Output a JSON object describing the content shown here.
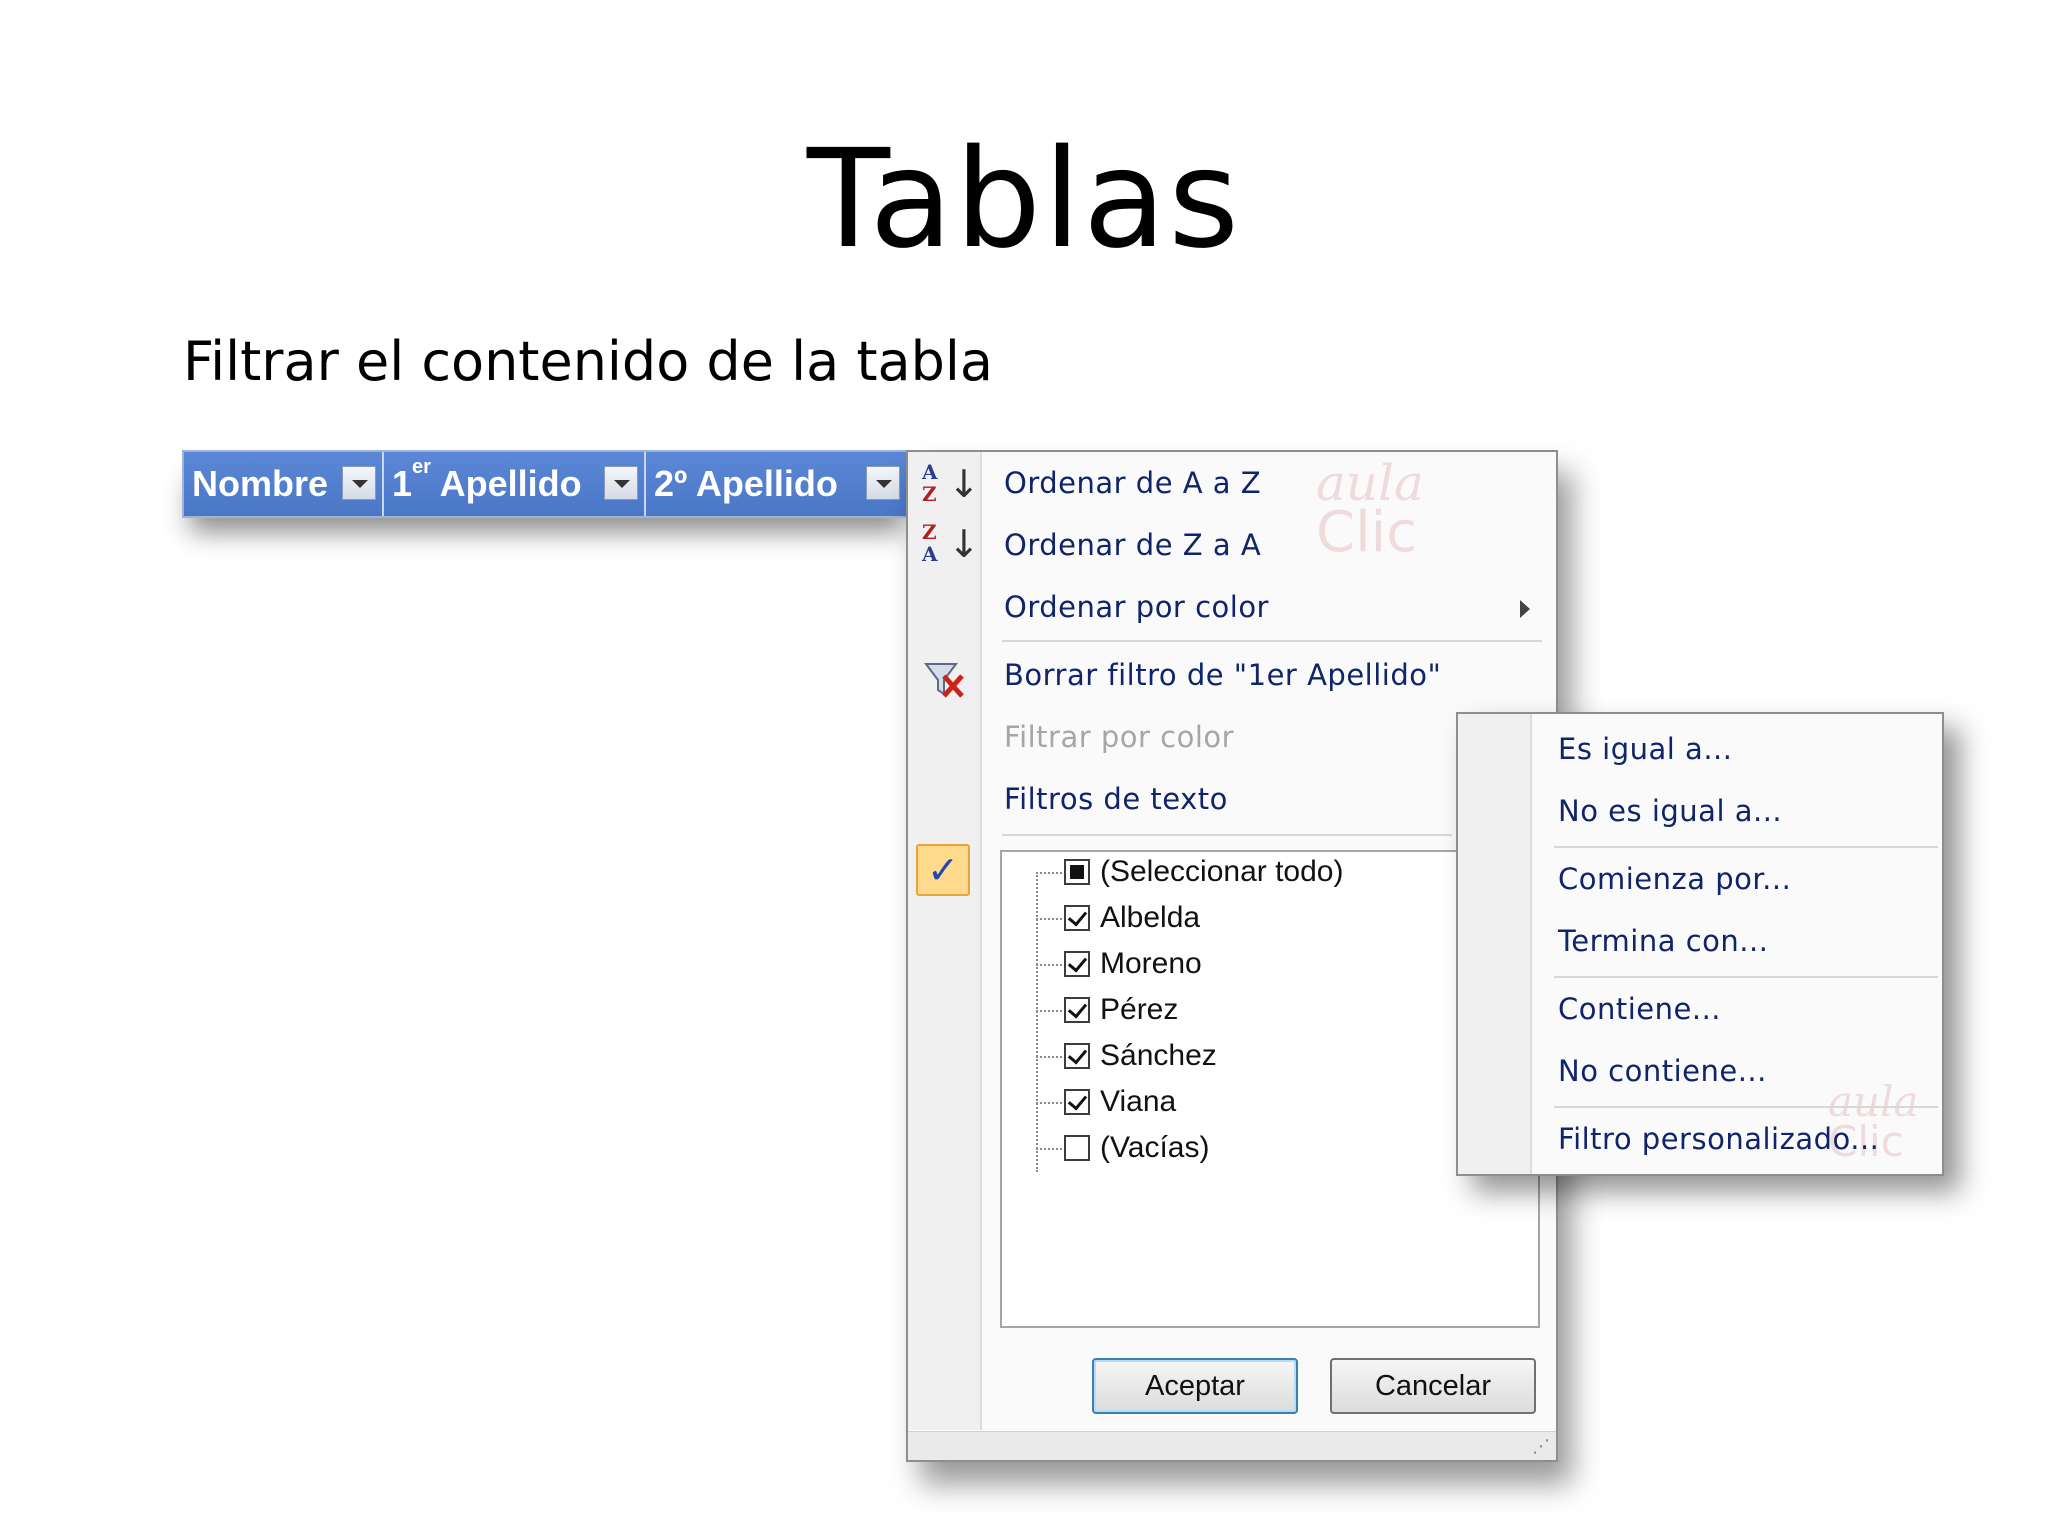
{
  "slide": {
    "title": "Tablas",
    "subtitle": "Filtrar el contenido de la tabla"
  },
  "table_header": {
    "columns": [
      {
        "label": "Nombre"
      },
      {
        "label_main": "1",
        "label_sup": "er",
        "label_rest": " Apellido"
      },
      {
        "label": "2º Apellido"
      }
    ],
    "color": "#4a76c6"
  },
  "filter_menu": {
    "items": {
      "sort_az": "Ordenar de A a Z",
      "sort_za": "Ordenar de Z a A",
      "sort_color": "Ordenar por color",
      "clear_filter": "Borrar filtro de \"1er Apellido\"",
      "filter_color": "Filtrar por color",
      "text_filters": "Filtros de texto"
    },
    "values": [
      {
        "label": "(Seleccionar todo)",
        "state": "partial"
      },
      {
        "label": "Albelda",
        "state": "checked"
      },
      {
        "label": "Moreno",
        "state": "checked"
      },
      {
        "label": "Pérez",
        "state": "checked"
      },
      {
        "label": "Sánchez",
        "state": "checked"
      },
      {
        "label": "Viana",
        "state": "checked"
      },
      {
        "label": "(Vacías)",
        "state": "unchecked"
      }
    ],
    "ok_button": "Aceptar",
    "cancel_button": "Cancelar",
    "watermark": {
      "line1": "aula",
      "line2": "Clic"
    }
  },
  "text_filters_submenu": {
    "items": [
      "Es igual a...",
      "No es igual a...",
      "Comienza por...",
      "Termina con...",
      "Contiene...",
      "No contiene...",
      "Filtro personalizado..."
    ],
    "watermark": {
      "line1": "aula",
      "line2": "Clic"
    }
  },
  "icons": {
    "sort_az": "sort-ascending-icon",
    "sort_za": "sort-descending-icon",
    "clear_filter": "clear-filter-icon",
    "check": "checkmark-icon",
    "submenu_arrow": "chevron-right-icon",
    "dropdown": "dropdown-arrow-icon"
  }
}
